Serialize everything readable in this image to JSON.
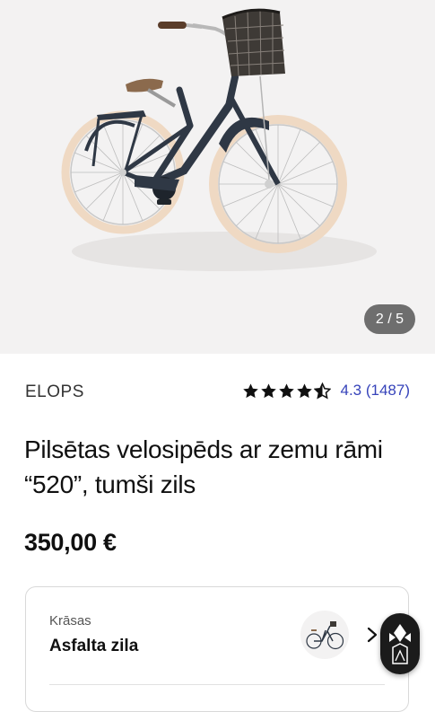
{
  "gallery": {
    "page_counter": "2 / 5",
    "image": "city-bike-with-basket"
  },
  "product": {
    "brand": "ELOPS",
    "rating": {
      "stars": 4.3,
      "text": "4.3 (1487)"
    },
    "title": "Pilsētas velosipēds ar zemu rāmi “520”, tumši zils",
    "price": "350,00 €"
  },
  "color_selector": {
    "label": "Krāsas",
    "value": "Asfalta zila"
  },
  "floating_button": {
    "icon": "assistant-logo-icon"
  },
  "colors": {
    "accent": "#3643ba",
    "text": "#101010",
    "frame": "#2f3845",
    "tire": "#f1dcc6"
  }
}
